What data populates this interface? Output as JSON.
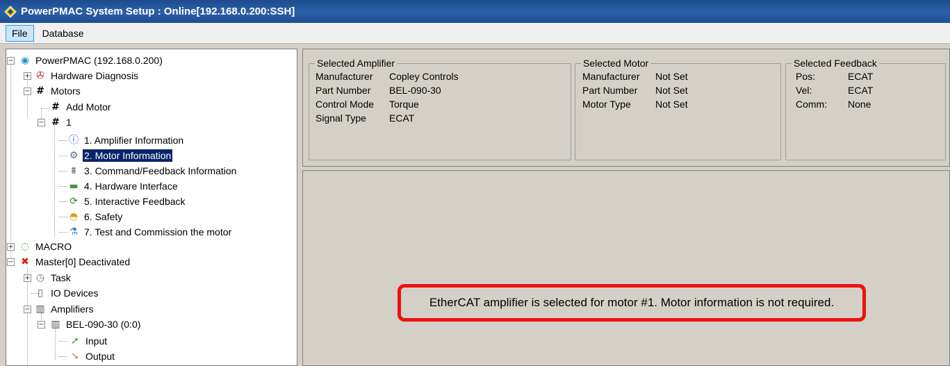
{
  "window": {
    "title": "PowerPMAC System Setup  : Online[192.168.0.200:SSH]",
    "app_icon": "powerpmac-diamond-icon"
  },
  "menu": {
    "items": [
      "File",
      "Database"
    ]
  },
  "tree": {
    "root": "PowerPMAC (192.168.0.200)",
    "hardware_diagnosis": "Hardware Diagnosis",
    "motors": "Motors",
    "add_motor": "Add Motor",
    "motor_1": "1",
    "motor_items": [
      "1. Amplifier Information",
      "2. Motor Information",
      "3. Command/Feedback Information",
      "4. Hardware Interface",
      "5. Interactive Feedback",
      "6. Safety",
      "7. Test and Commission the motor"
    ],
    "macro": "MACRO",
    "master": "Master[0] Deactivated",
    "task": "Task",
    "io_devices": "IO Devices",
    "amplifiers": "Amplifiers",
    "amp_device": "BEL-090-30 (0:0)",
    "input": "Input",
    "output": "Output",
    "selected_item": "2. Motor Information"
  },
  "selected_amplifier": {
    "legend": "Selected Amplifier",
    "rows": [
      {
        "label": "Manufacturer",
        "value": "Copley Controls"
      },
      {
        "label": "Part Number",
        "value": "BEL-090-30"
      },
      {
        "label": "Control Mode",
        "value": "Torque"
      },
      {
        "label": "Signal Type",
        "value": "ECAT"
      }
    ]
  },
  "selected_motor": {
    "legend": "Selected Motor",
    "rows": [
      {
        "label": "Manufacturer",
        "value": "Not Set"
      },
      {
        "label": "Part Number",
        "value": "Not Set"
      },
      {
        "label": "Motor Type",
        "value": "Not Set"
      }
    ]
  },
  "selected_feedback": {
    "legend": "Selected Feedback",
    "rows": [
      {
        "label": "Pos:",
        "value": "ECAT"
      },
      {
        "label": "Vel:",
        "value": "ECAT"
      },
      {
        "label": "Comm:",
        "value": "None"
      }
    ]
  },
  "message": "EtherCAT amplifier is selected for motor #1. Motor information is not required.",
  "colors": {
    "highlight": "#ee1111",
    "selection": "#0a246a",
    "titlebar": "#2b5fa7"
  }
}
